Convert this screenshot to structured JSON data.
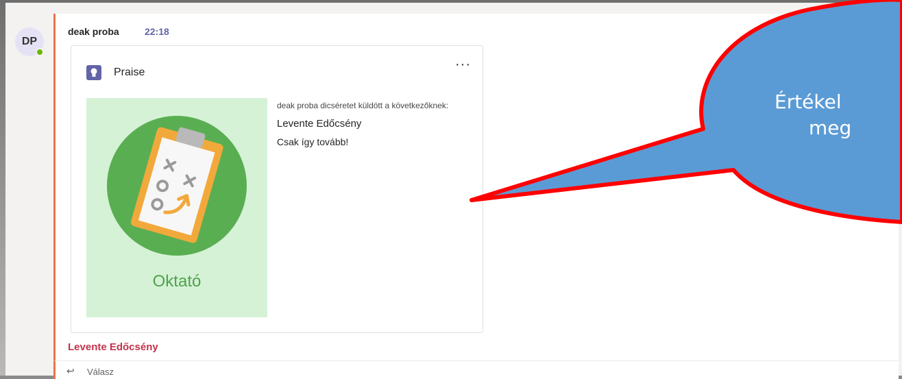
{
  "message": {
    "avatar_initials": "DP",
    "sender": "deak proba",
    "time": "22:18",
    "mention": "Levente Edőcsény"
  },
  "card": {
    "type_label": "Praise",
    "more_label": "···",
    "badge_title": "Oktató",
    "sent_text": "deak proba dicséretet küldött a következőknek:",
    "recipient": "Levente Edőcsény",
    "praise_message": "Csak így tovább!"
  },
  "reply": {
    "label": "Válasz",
    "icon": "reply-arrow-icon"
  },
  "callout": {
    "line1": "Értékel",
    "line2": "meg"
  },
  "colors": {
    "accent_bar": "#e97548",
    "teams_purple": "#6264a7",
    "mention_red": "#c4314b",
    "badge_bg": "#d5f2d6",
    "badge_circle": "#5aae52",
    "callout_fill": "#5b9bd5",
    "callout_stroke": "#ff0000"
  }
}
